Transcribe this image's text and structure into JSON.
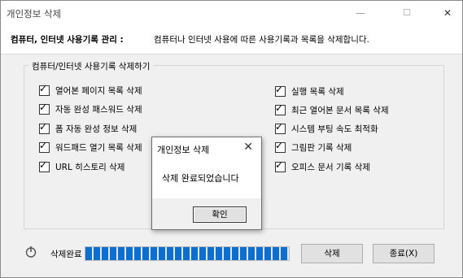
{
  "window": {
    "title": "개인정보 삭제",
    "minimize": "—",
    "maximize": "☐",
    "close": "✕"
  },
  "header": {
    "label": "컴퓨터, 인터넷 사용기록 관리 :",
    "description": "컴퓨터나 인터넷 사용에 따른 사용기록과 목록을 삭제합니다."
  },
  "group": {
    "title": "컴퓨터/인터넷 사용기록 삭제하기",
    "left_items": [
      {
        "label": "열어본 페이지 목록 삭제",
        "checked": true
      },
      {
        "label": "자동 완성 패스워드 삭제",
        "checked": true
      },
      {
        "label": "폼 자동 완성 정보 삭제",
        "checked": true
      },
      {
        "label": "워드패드 열기 목록 삭제",
        "checked": true
      },
      {
        "label": "URL 히스토리 삭제",
        "checked": true
      }
    ],
    "right_items": [
      {
        "label": "실행 목록 삭제",
        "checked": true
      },
      {
        "label": "최근 열어본 문서 목록 삭제",
        "checked": true
      },
      {
        "label": "시스템 부팅 속도 최적화",
        "checked": true
      },
      {
        "label": "그림판 기록 삭제",
        "checked": true
      },
      {
        "label": "오피스 문서 기록 삭제",
        "checked": true
      }
    ]
  },
  "dialog": {
    "title": "개인정보 삭제",
    "close": "✕",
    "message": "삭제 완료되었습니다",
    "ok_label": "확인"
  },
  "footer": {
    "status_label": "삭제완료",
    "progress": 1.0,
    "delete_label": "삭제",
    "exit_label": "종료(X)"
  },
  "check_mark": "✓",
  "colors": {
    "progress": "#0b6fd1"
  }
}
